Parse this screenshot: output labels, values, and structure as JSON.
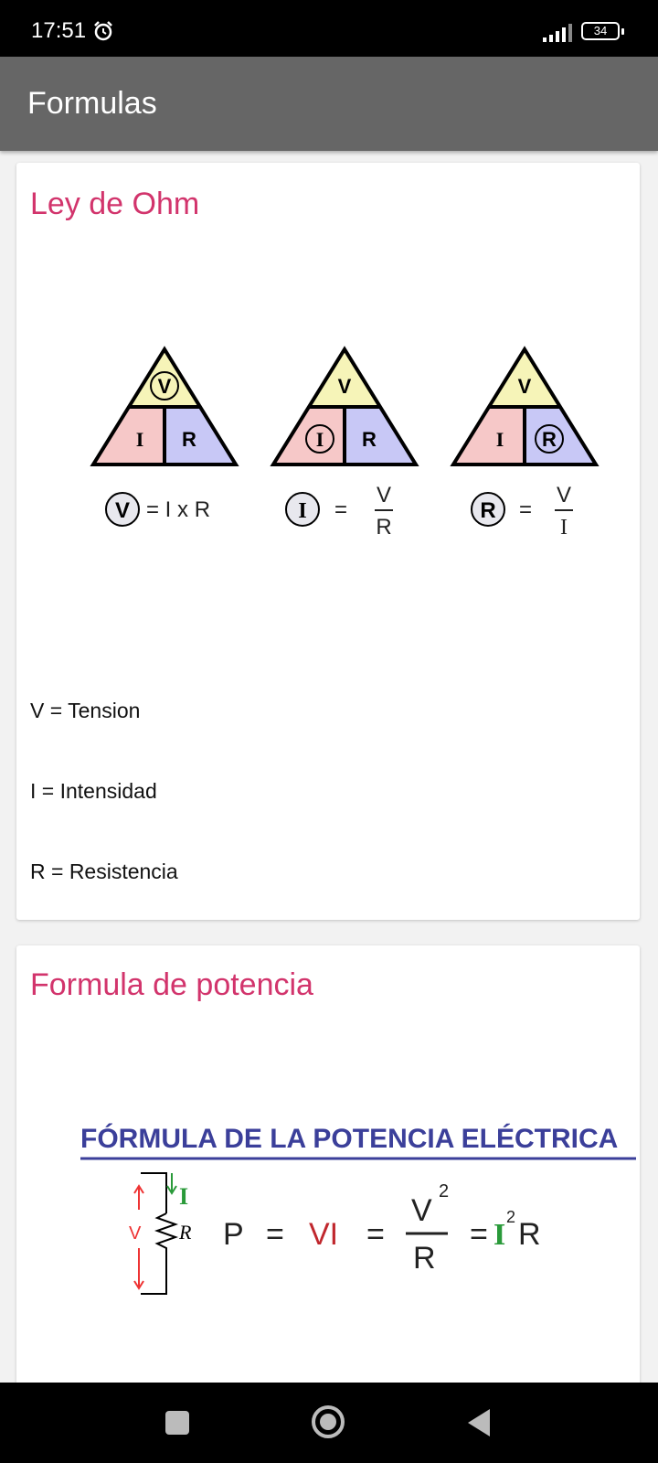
{
  "status": {
    "time": "17:51",
    "battery": "34"
  },
  "app": {
    "title": "Formulas"
  },
  "ohm": {
    "title": "Ley de Ohm",
    "triangle": {
      "top": "V",
      "left": "I",
      "right": "R"
    },
    "formulas": {
      "v": {
        "subject": "V",
        "rhs": "= I x R"
      },
      "i": {
        "subject": "I",
        "eq": "=",
        "num": "V",
        "den": "R"
      },
      "r": {
        "subject": "R",
        "eq": "=",
        "num": "V",
        "den": "I"
      }
    },
    "legend": [
      "V = Tension",
      "I = Intensidad",
      "R = Resistencia"
    ]
  },
  "power": {
    "title": "Formula de potencia",
    "heading": "FÓRMULA DE LA POTENCIA ELÉCTRICA",
    "circuit": {
      "v": "V",
      "i": "I",
      "r": "R"
    },
    "formula": {
      "p": "P",
      "eq": "=",
      "vi": "VI",
      "num": "V",
      "exp": "2",
      "den": "R",
      "i": "I",
      "r": "R"
    }
  },
  "colors": {
    "accent": "#d2346c",
    "appbar": "#666666",
    "tri_top": "#f6f4b8",
    "tri_left": "#f6c8c8",
    "tri_right": "#c8c8f6",
    "heading": "#3b3f9a"
  }
}
